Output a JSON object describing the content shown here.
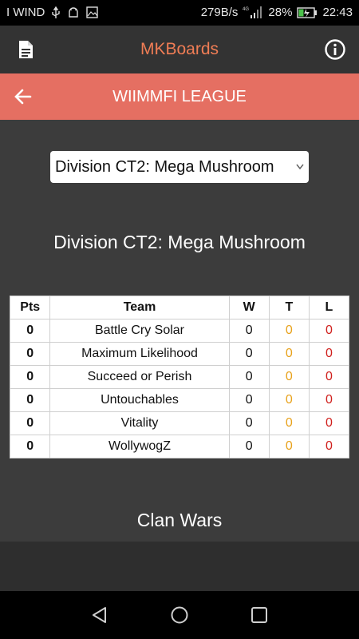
{
  "status_bar": {
    "carrier": "I WIND",
    "speed": "279B/s",
    "network_type": "4G",
    "battery": "28%",
    "time": "22:43"
  },
  "app_bar": {
    "title": "MKBoards",
    "left_icon": "document-icon",
    "right_icon": "info-icon"
  },
  "header": {
    "title": "WIIMMFI LEAGUE",
    "back_icon": "arrow-left-icon"
  },
  "division_select": {
    "value": "Division CT2: Mega Mushroom"
  },
  "division_title": "Division CT2: Mega Mushroom",
  "standings": {
    "columns": [
      "Pts",
      "Team",
      "W",
      "T",
      "L"
    ],
    "rows": [
      {
        "pts": "0",
        "team": "Battle Cry Solar",
        "w": "0",
        "t": "0",
        "l": "0"
      },
      {
        "pts": "0",
        "team": "Maximum Likelihood",
        "w": "0",
        "t": "0",
        "l": "0"
      },
      {
        "pts": "0",
        "team": "Succeed or Perish",
        "w": "0",
        "t": "0",
        "l": "0"
      },
      {
        "pts": "0",
        "team": "Untouchables",
        "w": "0",
        "t": "0",
        "l": "0"
      },
      {
        "pts": "0",
        "team": "Vitality",
        "w": "0",
        "t": "0",
        "l": "0"
      },
      {
        "pts": "0",
        "team": "WollywogZ",
        "w": "0",
        "t": "0",
        "l": "0"
      }
    ]
  },
  "section_title": "Clan Wars",
  "colors": {
    "accent": "#f07d55",
    "header_bg": "#e56f62",
    "tie": "#e8a21c",
    "loss": "#d0201d"
  }
}
